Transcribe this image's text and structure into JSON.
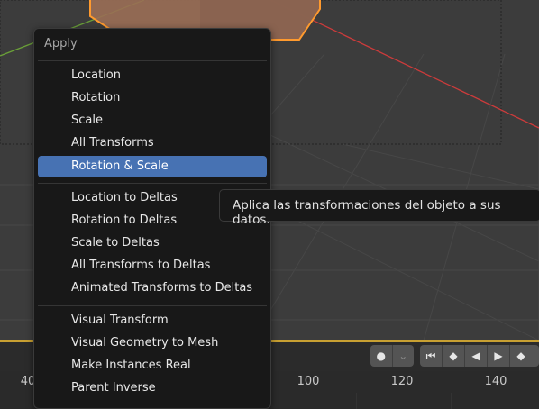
{
  "colors": {
    "viewport_bg": "#3c3c3c",
    "menu_bg": "#181818",
    "highlight": "#4772b3",
    "selection_outline": "#ff9a2e",
    "x_axis": "#cc3b3b",
    "y_axis": "#6aa038",
    "timeline_accent": "#c8a032"
  },
  "menu": {
    "title": "Apply",
    "groups": [
      [
        "Location",
        "Rotation",
        "Scale",
        "All Transforms",
        "Rotation & Scale"
      ],
      [
        "Location to Deltas",
        "Rotation to Deltas",
        "Scale to Deltas",
        "All Transforms to Deltas",
        "Animated Transforms to Deltas"
      ],
      [
        "Visual Transform",
        "Visual Geometry to Mesh",
        "Make Instances Real",
        "Parent Inverse"
      ]
    ],
    "highlighted": "Rotation & Scale"
  },
  "tooltip": {
    "text": "Aplica las transformaciones del objeto a sus datos."
  },
  "timeline": {
    "ruler_labels": [
      "40",
      "100",
      "120",
      "140"
    ],
    "playback_icons": [
      "record-icon",
      "chevron-down-icon",
      "jump-start-icon",
      "prev-keyframe-icon",
      "play-reverse-icon",
      "play-icon",
      "next-keyframe-icon"
    ]
  }
}
